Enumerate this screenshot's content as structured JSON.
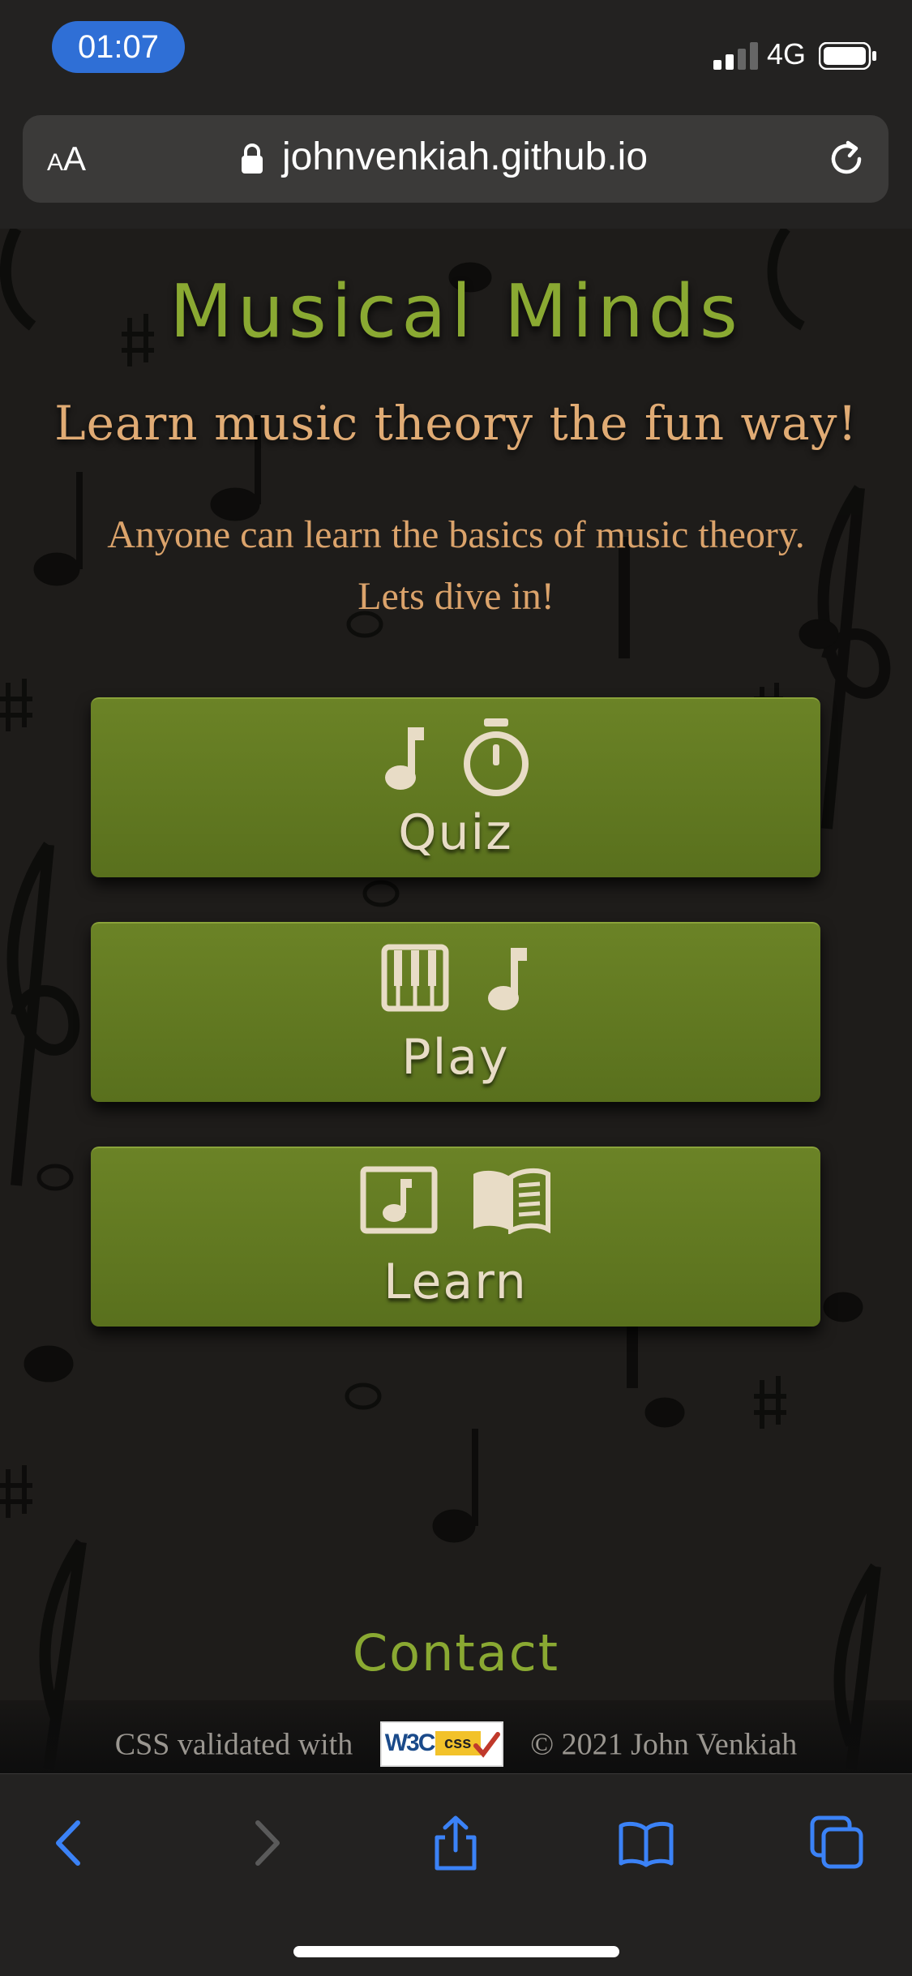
{
  "status_bar": {
    "time": "01:07",
    "network": "4G"
  },
  "browser": {
    "text_size_label_small": "A",
    "text_size_label_large": "A",
    "url": "johnvenkiah.github.io"
  },
  "page": {
    "title": "Musical Minds",
    "tagline": "Learn music theory the fun way!",
    "intro_line1": "Anyone can learn the basics of music theory.",
    "intro_line2": "Lets dive in!",
    "buttons": [
      {
        "label": "Quiz",
        "icons": [
          "music-note-icon",
          "stopwatch-icon"
        ]
      },
      {
        "label": "Play",
        "icons": [
          "piano-keys-icon",
          "music-note-icon"
        ]
      },
      {
        "label": "Learn",
        "icons": [
          "music-note-square-icon",
          "book-icon"
        ]
      }
    ],
    "contact": "Contact",
    "footer": {
      "validated_text": "CSS validated with",
      "badge_w3c": "W3C",
      "badge_css": "css",
      "copyright": "© 2021 John Venkiah"
    }
  },
  "colors": {
    "title": "#8aa932",
    "tagline": "#e0ab74",
    "button": "#637c22",
    "button_text": "#e8dcc6",
    "ios_blue": "#3b82f6"
  },
  "toolbar": {
    "items": [
      "back-icon",
      "forward-icon",
      "share-icon",
      "bookmarks-icon",
      "tabs-icon"
    ]
  }
}
